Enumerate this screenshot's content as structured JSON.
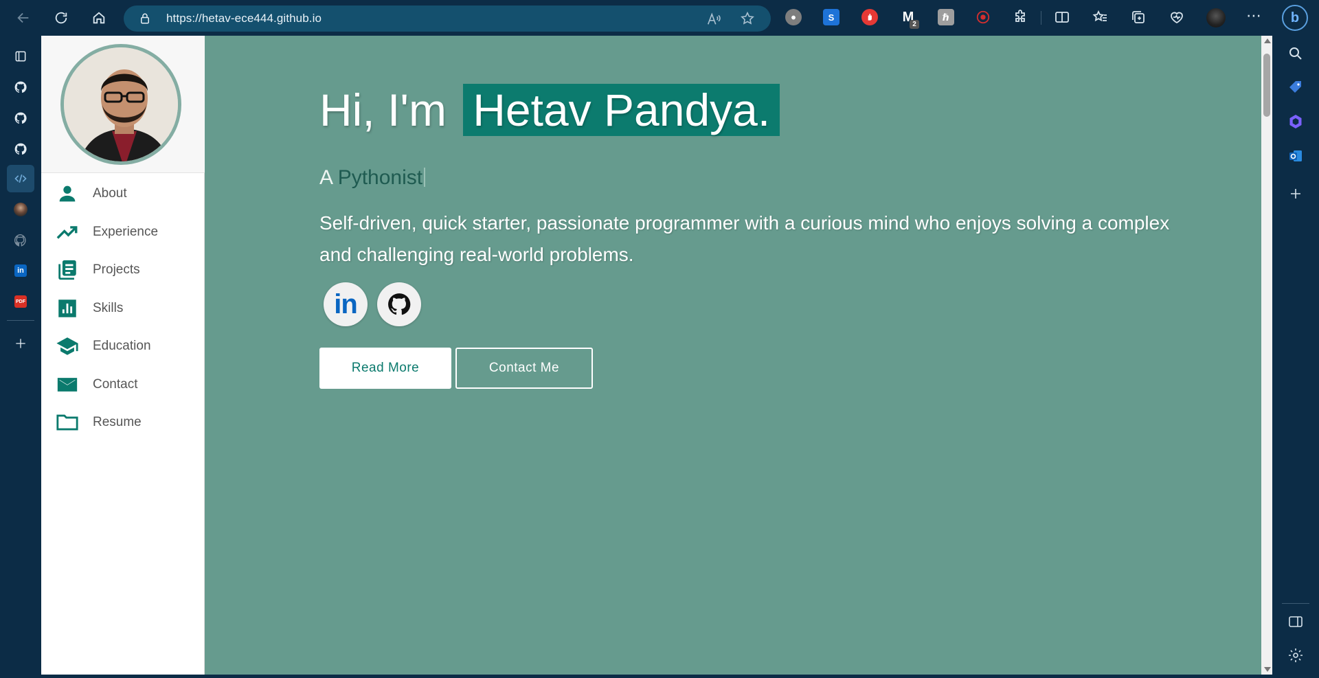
{
  "browser": {
    "url": "https://hetav-ece444.github.io",
    "extensions": [
      {
        "icon": "extension-camera-icon",
        "color": "#8d8d8d"
      },
      {
        "icon": "extension-s-icon",
        "label": "S",
        "color": "#1e73d8"
      },
      {
        "icon": "extension-hand-icon",
        "color": "#e53935"
      },
      {
        "icon": "extension-malwarebytes-icon",
        "label": "M",
        "badge": "2",
        "color": "#ffffff"
      },
      {
        "icon": "extension-hrn-icon",
        "label": "ℏ",
        "color": "#9e9e9e"
      },
      {
        "icon": "extension-record-icon",
        "color": "#d32f2f"
      }
    ]
  },
  "vertical_tabs": [
    {
      "icon": "tab-actions-icon"
    },
    {
      "icon": "github-tab-icon"
    },
    {
      "icon": "github-tab-icon"
    },
    {
      "icon": "github-tab-icon"
    },
    {
      "icon": "code-tab-icon",
      "active": true
    },
    {
      "icon": "profile-tab-icon"
    },
    {
      "icon": "github-tab-icon"
    },
    {
      "icon": "linkedin-tab-icon"
    },
    {
      "icon": "pdf-tab-icon"
    }
  ],
  "site": {
    "nav": [
      {
        "label": "About",
        "icon": "person-icon"
      },
      {
        "label": "Experience",
        "icon": "trending-up-icon"
      },
      {
        "label": "Projects",
        "icon": "library-books-icon"
      },
      {
        "label": "Skills",
        "icon": "bar-chart-icon"
      },
      {
        "label": "Education",
        "icon": "graduation-cap-icon"
      },
      {
        "label": "Contact",
        "icon": "mail-icon"
      },
      {
        "label": "Resume",
        "icon": "folder-icon"
      }
    ],
    "hero": {
      "greeting": "Hi, I'm",
      "name": "Hetav Pandya.",
      "tagline_prefix": "A",
      "tagline_role": "Pythonist",
      "bio": "Self-driven, quick starter, passionate programmer with a curious mind who enjoys solving a complex and challenging real-world problems.",
      "read_more": "Read More",
      "contact_me": "Contact Me"
    },
    "social": [
      {
        "icon": "linkedin-icon",
        "label": "in"
      },
      {
        "icon": "github-icon"
      }
    ],
    "accent_color": "#0c7b6e",
    "background_color": "#669b8e"
  }
}
